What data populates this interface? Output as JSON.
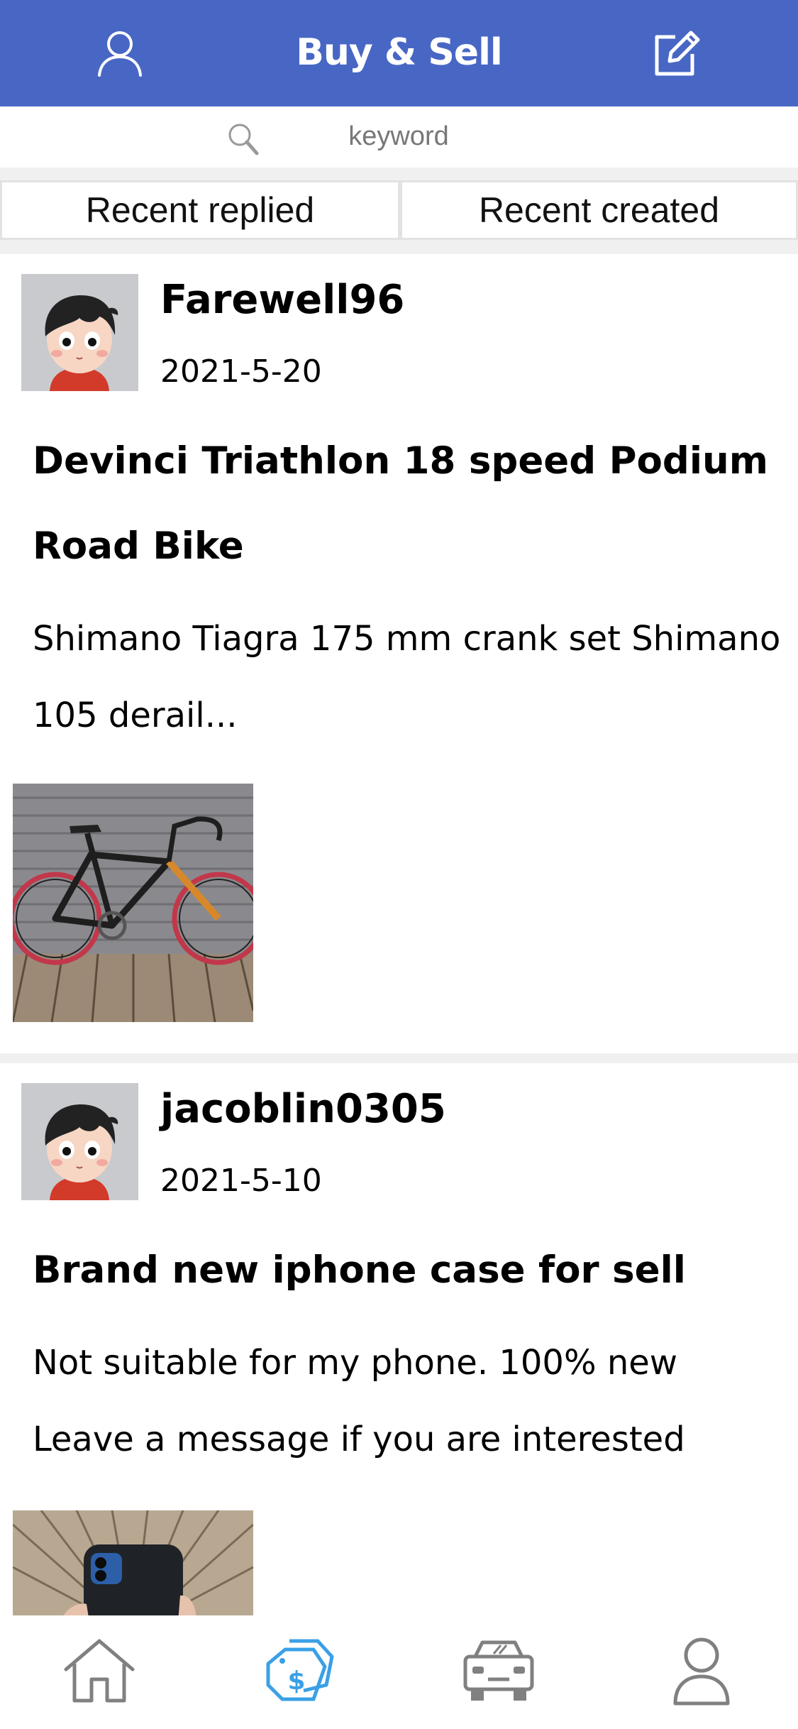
{
  "header": {
    "title": "Buy & Sell",
    "icons": [
      "user-icon",
      "edit-icon"
    ],
    "color": "#4867c4"
  },
  "search": {
    "placeholder": "keyword",
    "icon": "search-icon"
  },
  "tabs": [
    {
      "label": "Recent replied"
    },
    {
      "label": "Recent created"
    }
  ],
  "posts": [
    {
      "author": "Farewell96",
      "date": "2021-5-20",
      "title": "Devinci Triathlon 18 speed Podium Road Bike",
      "body": "Shimano Tiagra 175 mm crank set Shimano 105 derail...",
      "image": "bike-photo"
    },
    {
      "author": "jacoblin0305",
      "date": "2021-5-10",
      "title": "Brand new iphone case for sell",
      "body": "Not suitable for my phone. 100% new Leave a message if you are interested",
      "image": "phone-case-photo"
    }
  ],
  "bottom_nav": {
    "items": [
      {
        "icon": "home-icon"
      },
      {
        "icon": "price-tag-icon",
        "active": true
      },
      {
        "icon": "car-icon"
      },
      {
        "icon": "profile-icon"
      }
    ],
    "active_color": "#3aa0e6",
    "inactive_color": "#808080"
  }
}
